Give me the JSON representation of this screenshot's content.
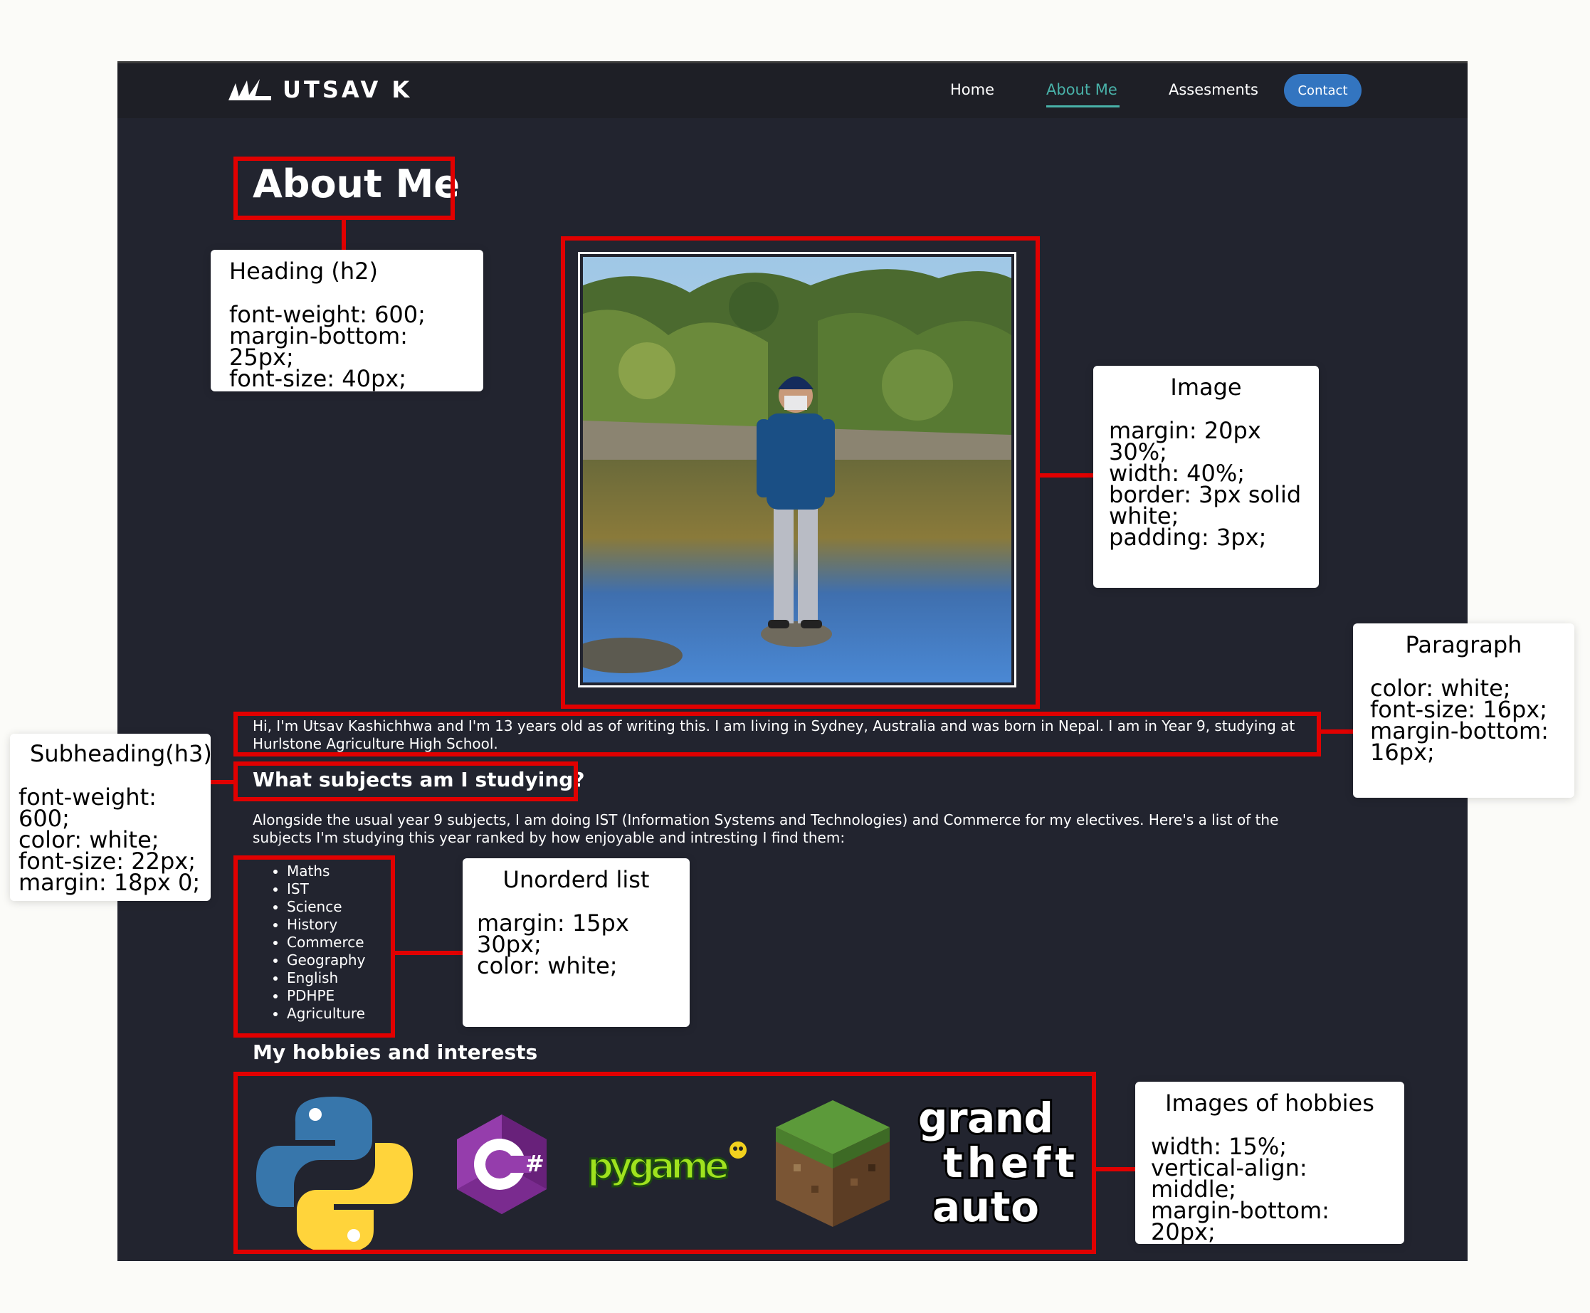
{
  "nav": {
    "brand": "UTSAV K",
    "links": [
      {
        "label": "Home"
      },
      {
        "label": "About Me",
        "active": true
      },
      {
        "label": "Assesments"
      }
    ],
    "contact": "Contact"
  },
  "page": {
    "title": "About Me",
    "photo_caption": "",
    "intro": "Hi, I'm Utsav Kashichhwa and I'm 13 years old as of writing this. I am living in Sydney, Australia and was born in Nepal. I am in Year 9, studying at Hurlstone Agriculture High School.",
    "subjects_heading": "What subjects am I studying?",
    "subjects_intro": "Alongside the usual year 9 subjects, I am doing IST (Information Systems and Technologies) and Commerce for my electives. Here's a list of the subjects I'm studying this year ranked by how enjoyable and intresting I find them:",
    "subjects": [
      "Maths",
      "IST",
      "Science",
      "History",
      "Commerce",
      "Geography",
      "English",
      "PDHPE",
      "Agriculture"
    ],
    "hobbies_heading": "My hobbies and interests",
    "hobbies": [
      {
        "icon": "python-logo-icon"
      },
      {
        "icon": "csharp-logo-icon"
      },
      {
        "icon": "pygame-logo",
        "text": "pygame"
      },
      {
        "icon": "minecraft-grass-block-icon"
      },
      {
        "icon": "gta-logo",
        "lines": [
          "grand",
          "theft",
          "auto"
        ]
      }
    ]
  },
  "annotations": {
    "heading": {
      "title": "Heading (h2)",
      "body": "font-weight: 600;\nmargin-bottom: 25px;\nfont-size: 40px;"
    },
    "image": {
      "title": "Image",
      "body": "margin: 20px 30%;\nwidth: 40%;\nborder: 3px solid\nwhite;\npadding: 3px;"
    },
    "paragraph": {
      "title": "Paragraph",
      "body": "color: white;\nfont-size: 16px;\nmargin-bottom:\n16px;"
    },
    "subheading": {
      "title": "Subheading(h3)",
      "body": "font-weight: 600;\ncolor: white;\nfont-size: 22px;\nmargin: 18px 0;"
    },
    "list": {
      "title": "Unorderd list",
      "body": "margin: 15px 30px;\ncolor: white;"
    },
    "hobby_images": {
      "title": "Images of hobbies",
      "body": "width: 15%;\nvertical-align: middle;\nmargin-bottom: 20px;"
    }
  },
  "colors": {
    "page_bg": "#22242f",
    "nav_bg": "#1e1f26",
    "accent": "#49b2a9",
    "contact_button": "#3375c0",
    "annotation_red": "#e10000"
  }
}
